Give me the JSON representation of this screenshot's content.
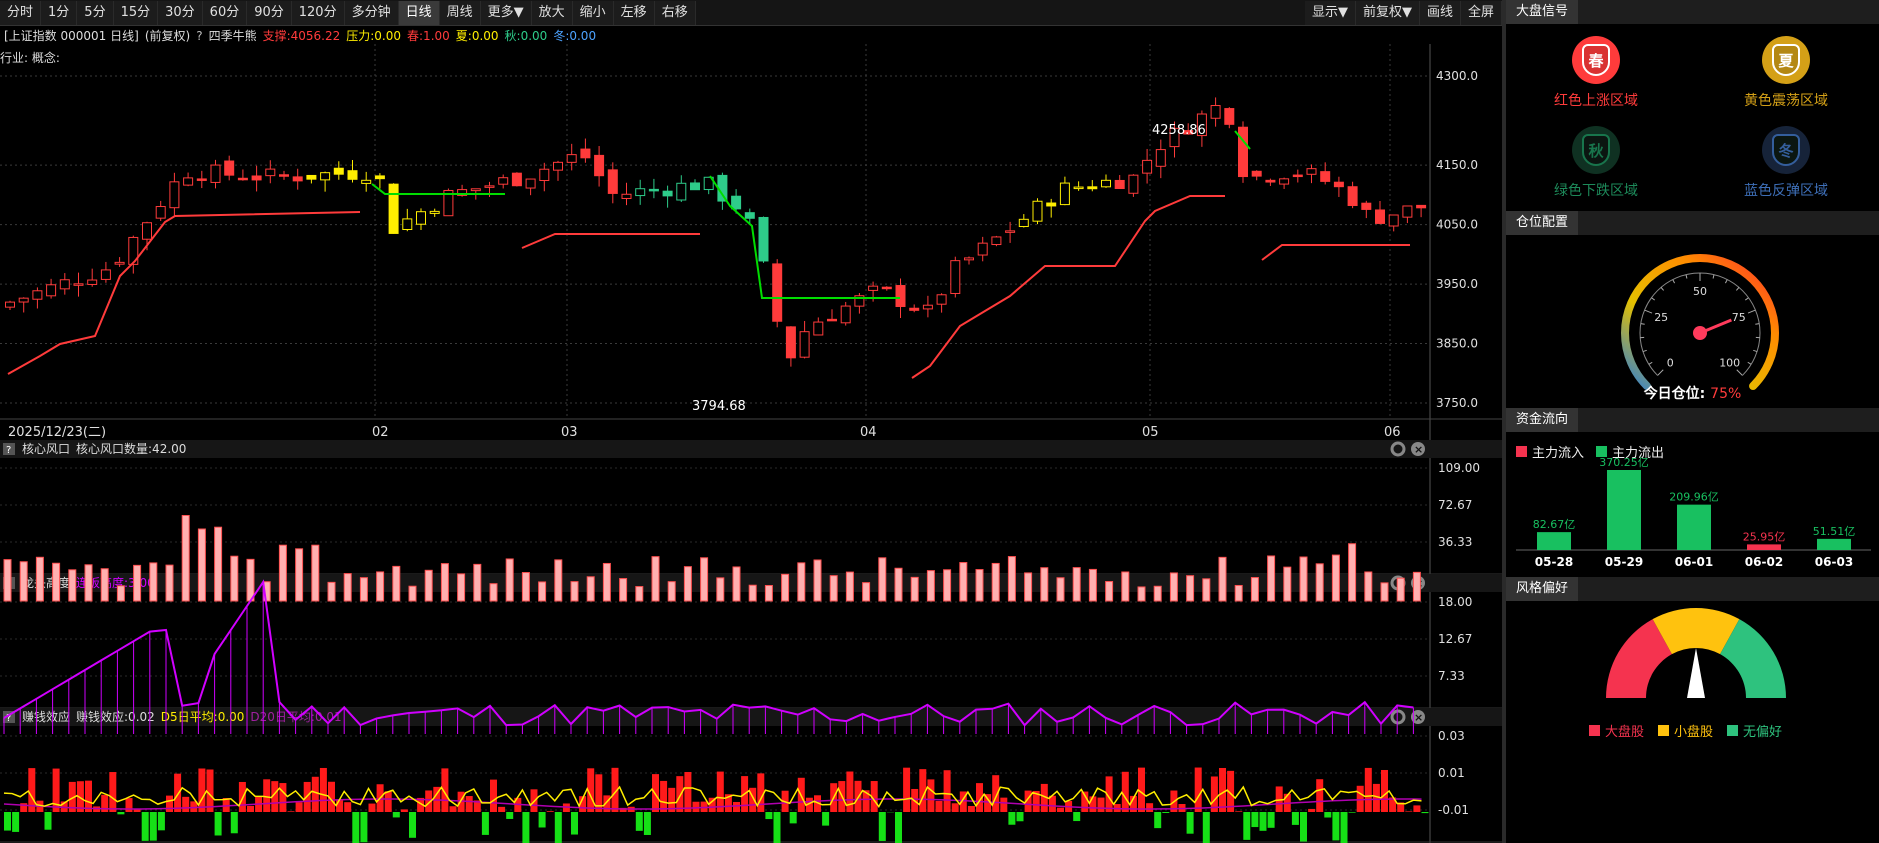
{
  "toolbar": {
    "periods": [
      "分时",
      "1分",
      "5分",
      "15分",
      "30分",
      "60分",
      "90分",
      "120分",
      "多分钟",
      "日线",
      "周线",
      "更多▼",
      "放大",
      "缩小",
      "左移",
      "右移"
    ],
    "right": [
      "显示▼",
      "前复权▼",
      "画线",
      "全屏"
    ]
  },
  "info": {
    "code": "[上证指数 000001 日线]",
    "adj": "(前复权)",
    "q": "?",
    "indicator": "四季牛熊",
    "support": "支撑:4056.22",
    "pressure": "压力:0.00",
    "spring": "春:1.00",
    "summer": "夏:0.00",
    "autumn": "秋:0.00",
    "winter": "冬:0.00",
    "industry": "行业: 概念:"
  },
  "colors": {
    "up": "#ff3b3b",
    "down": "#2ecc8a",
    "yellow": "#ffee00",
    "green": "#00dd00",
    "magenta": "#d000ff",
    "grid": "#3a3a3a",
    "axis": "#e0e0e0"
  },
  "main": {
    "price_ticks": [
      "4300.0",
      "4150.0",
      "4050.0",
      "3950.0",
      "3850.0",
      "3750.0"
    ],
    "dates": [
      "2025/12/23(二)",
      "02",
      "03",
      "04",
      "05",
      "06"
    ],
    "high_label": "4258.86",
    "low_label": "3794.68"
  },
  "panels": [
    {
      "title": "核心风口",
      "sub": "核心风口数量:42.00",
      "ticks": [
        "109.00",
        "72.67",
        "36.33"
      ]
    },
    {
      "title": "龙头高度",
      "sub": "连板高度:3.00",
      "ticks": [
        "18.00",
        "12.67",
        "7.33"
      ]
    },
    {
      "title": "赚钱效应",
      "sub": "赚钱效应:0.02",
      "d5": "D5日平均:0.00",
      "d20": "D20日平均:0.01",
      "ticks": [
        "0.03",
        "0.01",
        "-0.01"
      ]
    }
  ],
  "right_panel": {
    "signal_title": "大盘信号",
    "seasons": [
      {
        "char": "春",
        "label": "红色上涨区域",
        "color": "#ff3b3b"
      },
      {
        "char": "夏",
        "label": "黄色震荡区域",
        "color": "#d4a017"
      },
      {
        "char": "秋",
        "label": "绿色下跌区域",
        "color": "#1d8a5a"
      },
      {
        "char": "冬",
        "label": "蓝色反弹区域",
        "color": "#3e6fb8"
      }
    ],
    "position_title": "仓位配置",
    "gauge_ticks": [
      "0",
      "25",
      "50",
      "75",
      "100"
    ],
    "position_label": "今日仓位:",
    "position_value": "75%",
    "position_fraction": 0.75,
    "flow_title": "资金流向",
    "flow_in": "主力流入",
    "flow_out": "主力流出",
    "flow": [
      {
        "date": "05-28",
        "value": 82.67,
        "label": "82.67亿",
        "dir": "out"
      },
      {
        "date": "05-29",
        "value": 370.25,
        "label": "370.25亿",
        "dir": "out"
      },
      {
        "date": "06-01",
        "value": 209.96,
        "label": "209.96亿",
        "dir": "out"
      },
      {
        "date": "06-02",
        "value": 25.95,
        "label": "25.95亿",
        "dir": "in"
      },
      {
        "date": "06-03",
        "value": 51.51,
        "label": "51.51亿",
        "dir": "out"
      }
    ],
    "style_title": "风格偏好",
    "style_legend": [
      {
        "label": "大盘股",
        "color": "#f5334f"
      },
      {
        "label": "小盘股",
        "color": "#ffc20e"
      },
      {
        "label": "无偏好",
        "color": "#2ec27e"
      }
    ]
  }
}
